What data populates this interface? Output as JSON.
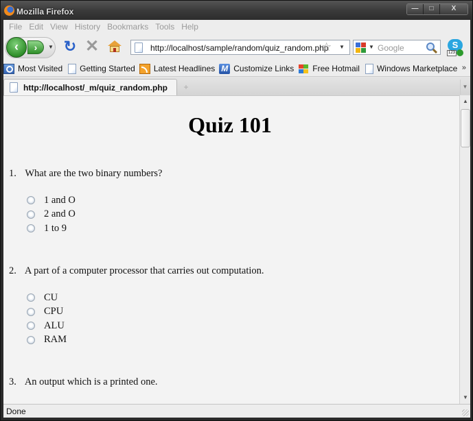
{
  "window": {
    "title": "Mozilla Firefox",
    "controls": {
      "minimize": "—",
      "maximize": "□",
      "close": "X"
    }
  },
  "menubar": [
    "File",
    "Edit",
    "View",
    "History",
    "Bookmarks",
    "Tools",
    "Help"
  ],
  "navbar": {
    "back_glyph": "‹",
    "forward_glyph": "›",
    "reload_glyph": "↻",
    "stop_glyph": "✕",
    "url": "http://localhost/sample/random/quiz_random.php",
    "bookmark_star": "☆",
    "search_placeholder": "Google",
    "skype_glyph": "S",
    "skype_badge": "123"
  },
  "bookmarks": {
    "items": [
      {
        "label": "Most Visited",
        "icon": "most-visited-icon"
      },
      {
        "label": "Getting Started",
        "icon": "page-icon"
      },
      {
        "label": "Latest Headlines",
        "icon": "rss-icon"
      },
      {
        "label": "Customize Links",
        "icon": "msn-icon"
      },
      {
        "label": "Free Hotmail",
        "icon": "windows-icon"
      },
      {
        "label": "Windows Marketplace",
        "icon": "page-icon"
      }
    ],
    "overflow": "»"
  },
  "tabs": [
    {
      "title": "http://localhost/_m/quiz_random.php",
      "active": true
    }
  ],
  "newtab_glyph": "+",
  "page": {
    "heading": "Quiz 101",
    "questions": [
      {
        "number": "1.",
        "text": "What are the two binary numbers?",
        "options": [
          "1 and O",
          "2 and O",
          "1 to 9"
        ]
      },
      {
        "number": "2.",
        "text": "A part of a computer processor that carries out computation.",
        "options": [
          "CU",
          "CPU",
          "ALU",
          "RAM"
        ]
      },
      {
        "number": "3.",
        "text": "An output which is a printed one.",
        "options": []
      }
    ]
  },
  "statusbar": {
    "status": "Done"
  }
}
